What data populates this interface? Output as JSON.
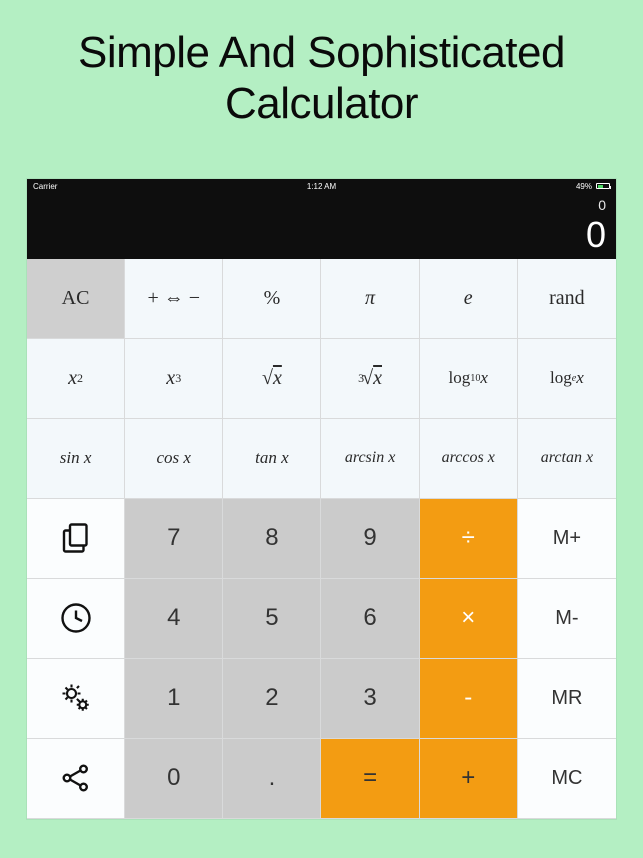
{
  "headline_line1": "Simple And Sophisticated",
  "headline_line2": "Calculator",
  "statusbar": {
    "carrier": "Carrier",
    "time": "1:12 AM",
    "battery_pct": "49%"
  },
  "display": {
    "secondary": "0",
    "primary": "0"
  },
  "keys": {
    "ac": "AC",
    "sign": "+ ⇔ −",
    "percent": "%",
    "pi": "π",
    "e": "e",
    "rand": "rand",
    "x2_base": "x",
    "x2_exp": "2",
    "x3_base": "x",
    "x3_exp": "3",
    "sqrt_sym": "√",
    "sqrt_x": "x",
    "cbrt_exp": "3",
    "cbrt_sym": "√",
    "cbrt_x": "x",
    "log10_a": "log",
    "log10_b": "10",
    "log10_x": " x",
    "ln_a": "log",
    "ln_b": "e",
    "ln_x": " x",
    "sin": "sin x",
    "cos": "cos x",
    "tan": "tan x",
    "asin": "arcsin x",
    "acos": "arccos x",
    "atan": "arctan x",
    "n7": "7",
    "n8": "8",
    "n9": "9",
    "div": "÷",
    "mplus": "M+",
    "n4": "4",
    "n5": "5",
    "n6": "6",
    "mul": "×",
    "mminus": "M-",
    "n1": "1",
    "n2": "2",
    "n3": "3",
    "sub": "-",
    "mr": "MR",
    "n0": "0",
    "dot": ".",
    "eq": "=",
    "add": "+",
    "mc": "MC"
  },
  "icons": {
    "copy": "copy-icon",
    "history": "clock-icon",
    "settings": "gears-icon",
    "share": "share-icon"
  }
}
